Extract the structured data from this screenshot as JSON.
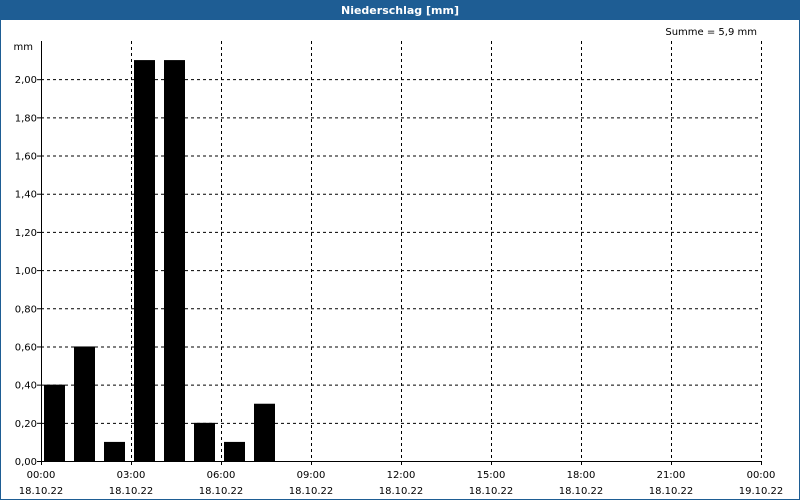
{
  "window": {
    "title": "Niederschlag [mm]"
  },
  "chart_data": {
    "type": "bar",
    "ylabel": "mm",
    "annotation": "Summe = 5,9 mm",
    "ylim": [
      0,
      2.2
    ],
    "yticks": [
      {
        "value": 0.0,
        "label": "0,00"
      },
      {
        "value": 0.2,
        "label": "0,20"
      },
      {
        "value": 0.4,
        "label": "0,40"
      },
      {
        "value": 0.6,
        "label": "0,60"
      },
      {
        "value": 0.8,
        "label": "0,80"
      },
      {
        "value": 1.0,
        "label": "1,00"
      },
      {
        "value": 1.2,
        "label": "1,20"
      },
      {
        "value": 1.4,
        "label": "1,40"
      },
      {
        "value": 1.6,
        "label": "1,60"
      },
      {
        "value": 1.8,
        "label": "1,80"
      },
      {
        "value": 2.0,
        "label": "2,00"
      }
    ],
    "xlim_hours": [
      0,
      24
    ],
    "xticks": [
      {
        "hour": 0,
        "time": "00:00",
        "date": "18.10.22"
      },
      {
        "hour": 3,
        "time": "03:00",
        "date": "18.10.22"
      },
      {
        "hour": 6,
        "time": "06:00",
        "date": "18.10.22"
      },
      {
        "hour": 9,
        "time": "09:00",
        "date": "18.10.22"
      },
      {
        "hour": 12,
        "time": "12:00",
        "date": "18.10.22"
      },
      {
        "hour": 15,
        "time": "15:00",
        "date": "18.10.22"
      },
      {
        "hour": 18,
        "time": "18:00",
        "date": "18.10.22"
      },
      {
        "hour": 21,
        "time": "21:00",
        "date": "18.10.22"
      },
      {
        "hour": 24,
        "time": "00:00",
        "date": "19.10.22"
      }
    ],
    "bars": [
      {
        "hour": 0,
        "value": 0.4
      },
      {
        "hour": 1,
        "value": 0.6
      },
      {
        "hour": 2,
        "value": 0.1
      },
      {
        "hour": 3,
        "value": 2.1
      },
      {
        "hour": 4,
        "value": 2.1
      },
      {
        "hour": 5,
        "value": 0.2
      },
      {
        "hour": 6,
        "value": 0.1
      },
      {
        "hour": 7,
        "value": 0.3
      }
    ],
    "bar_color": "#000000",
    "grid": true
  }
}
